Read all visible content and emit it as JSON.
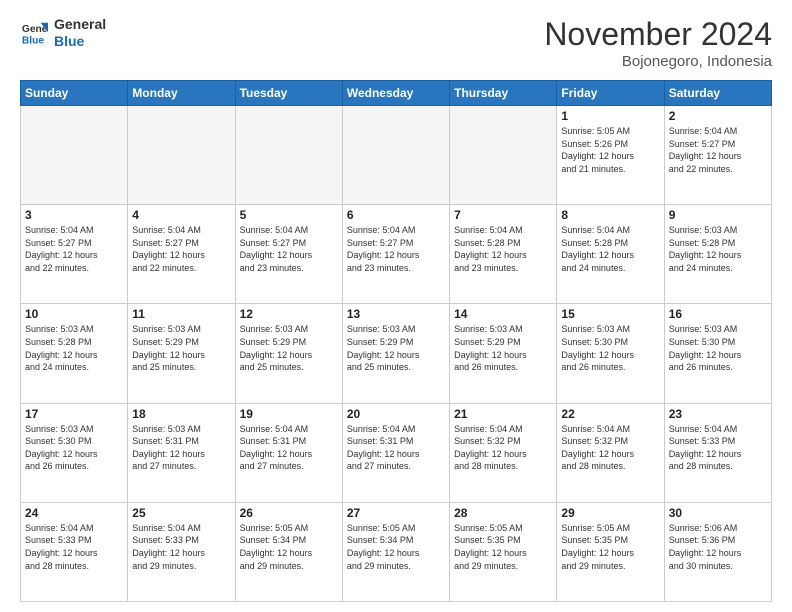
{
  "header": {
    "logo": {
      "line1": "General",
      "line2": "Blue"
    },
    "month": "November 2024",
    "location": "Bojonegoro, Indonesia"
  },
  "weekdays": [
    "Sunday",
    "Monday",
    "Tuesday",
    "Wednesday",
    "Thursday",
    "Friday",
    "Saturday"
  ],
  "weeks": [
    [
      {
        "day": "",
        "info": "",
        "empty": true
      },
      {
        "day": "",
        "info": "",
        "empty": true
      },
      {
        "day": "",
        "info": "",
        "empty": true
      },
      {
        "day": "",
        "info": "",
        "empty": true
      },
      {
        "day": "",
        "info": "",
        "empty": true
      },
      {
        "day": "1",
        "info": "Sunrise: 5:05 AM\nSunset: 5:26 PM\nDaylight: 12 hours\nand 21 minutes."
      },
      {
        "day": "2",
        "info": "Sunrise: 5:04 AM\nSunset: 5:27 PM\nDaylight: 12 hours\nand 22 minutes."
      }
    ],
    [
      {
        "day": "3",
        "info": "Sunrise: 5:04 AM\nSunset: 5:27 PM\nDaylight: 12 hours\nand 22 minutes."
      },
      {
        "day": "4",
        "info": "Sunrise: 5:04 AM\nSunset: 5:27 PM\nDaylight: 12 hours\nand 22 minutes."
      },
      {
        "day": "5",
        "info": "Sunrise: 5:04 AM\nSunset: 5:27 PM\nDaylight: 12 hours\nand 23 minutes."
      },
      {
        "day": "6",
        "info": "Sunrise: 5:04 AM\nSunset: 5:27 PM\nDaylight: 12 hours\nand 23 minutes."
      },
      {
        "day": "7",
        "info": "Sunrise: 5:04 AM\nSunset: 5:28 PM\nDaylight: 12 hours\nand 23 minutes."
      },
      {
        "day": "8",
        "info": "Sunrise: 5:04 AM\nSunset: 5:28 PM\nDaylight: 12 hours\nand 24 minutes."
      },
      {
        "day": "9",
        "info": "Sunrise: 5:03 AM\nSunset: 5:28 PM\nDaylight: 12 hours\nand 24 minutes."
      }
    ],
    [
      {
        "day": "10",
        "info": "Sunrise: 5:03 AM\nSunset: 5:28 PM\nDaylight: 12 hours\nand 24 minutes."
      },
      {
        "day": "11",
        "info": "Sunrise: 5:03 AM\nSunset: 5:29 PM\nDaylight: 12 hours\nand 25 minutes."
      },
      {
        "day": "12",
        "info": "Sunrise: 5:03 AM\nSunset: 5:29 PM\nDaylight: 12 hours\nand 25 minutes."
      },
      {
        "day": "13",
        "info": "Sunrise: 5:03 AM\nSunset: 5:29 PM\nDaylight: 12 hours\nand 25 minutes."
      },
      {
        "day": "14",
        "info": "Sunrise: 5:03 AM\nSunset: 5:29 PM\nDaylight: 12 hours\nand 26 minutes."
      },
      {
        "day": "15",
        "info": "Sunrise: 5:03 AM\nSunset: 5:30 PM\nDaylight: 12 hours\nand 26 minutes."
      },
      {
        "day": "16",
        "info": "Sunrise: 5:03 AM\nSunset: 5:30 PM\nDaylight: 12 hours\nand 26 minutes."
      }
    ],
    [
      {
        "day": "17",
        "info": "Sunrise: 5:03 AM\nSunset: 5:30 PM\nDaylight: 12 hours\nand 26 minutes."
      },
      {
        "day": "18",
        "info": "Sunrise: 5:03 AM\nSunset: 5:31 PM\nDaylight: 12 hours\nand 27 minutes."
      },
      {
        "day": "19",
        "info": "Sunrise: 5:04 AM\nSunset: 5:31 PM\nDaylight: 12 hours\nand 27 minutes."
      },
      {
        "day": "20",
        "info": "Sunrise: 5:04 AM\nSunset: 5:31 PM\nDaylight: 12 hours\nand 27 minutes."
      },
      {
        "day": "21",
        "info": "Sunrise: 5:04 AM\nSunset: 5:32 PM\nDaylight: 12 hours\nand 28 minutes."
      },
      {
        "day": "22",
        "info": "Sunrise: 5:04 AM\nSunset: 5:32 PM\nDaylight: 12 hours\nand 28 minutes."
      },
      {
        "day": "23",
        "info": "Sunrise: 5:04 AM\nSunset: 5:33 PM\nDaylight: 12 hours\nand 28 minutes."
      }
    ],
    [
      {
        "day": "24",
        "info": "Sunrise: 5:04 AM\nSunset: 5:33 PM\nDaylight: 12 hours\nand 28 minutes."
      },
      {
        "day": "25",
        "info": "Sunrise: 5:04 AM\nSunset: 5:33 PM\nDaylight: 12 hours\nand 29 minutes."
      },
      {
        "day": "26",
        "info": "Sunrise: 5:05 AM\nSunset: 5:34 PM\nDaylight: 12 hours\nand 29 minutes."
      },
      {
        "day": "27",
        "info": "Sunrise: 5:05 AM\nSunset: 5:34 PM\nDaylight: 12 hours\nand 29 minutes."
      },
      {
        "day": "28",
        "info": "Sunrise: 5:05 AM\nSunset: 5:35 PM\nDaylight: 12 hours\nand 29 minutes."
      },
      {
        "day": "29",
        "info": "Sunrise: 5:05 AM\nSunset: 5:35 PM\nDaylight: 12 hours\nand 29 minutes."
      },
      {
        "day": "30",
        "info": "Sunrise: 5:06 AM\nSunset: 5:36 PM\nDaylight: 12 hours\nand 30 minutes."
      }
    ]
  ]
}
